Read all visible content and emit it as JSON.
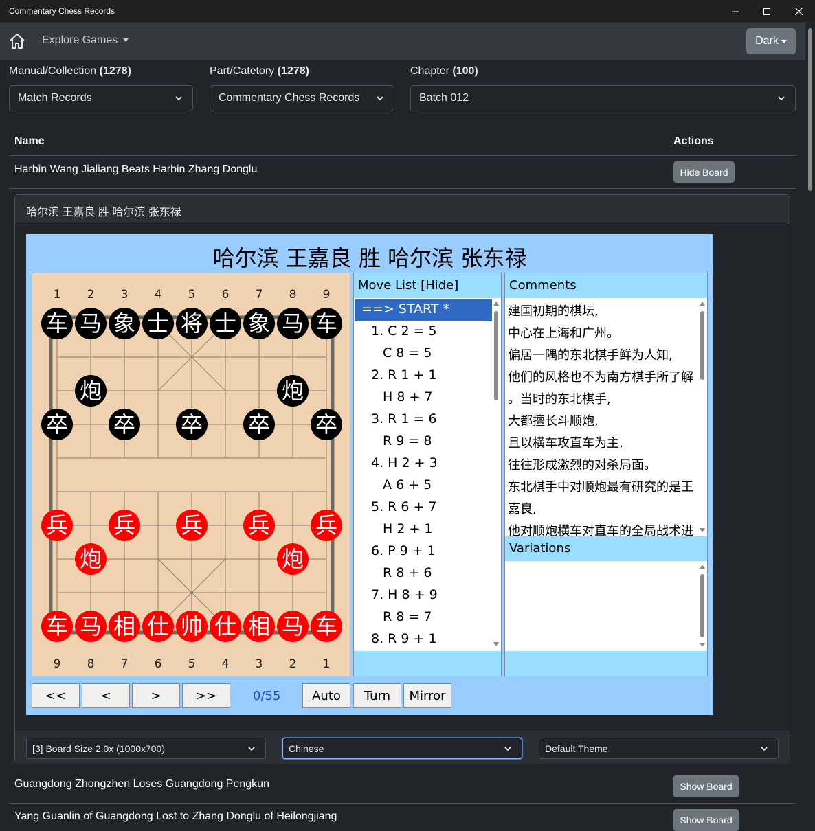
{
  "window": {
    "title": "Commentary Chess Records",
    "minimize": "—",
    "maximize": "☐",
    "close": "✕"
  },
  "navbar": {
    "home_icon": "home-icon",
    "explore_label": "Explore Games",
    "theme_label": "Dark"
  },
  "filters": [
    {
      "label": "Manual/Collection",
      "count": "(1278)",
      "value": "Match Records"
    },
    {
      "label": "Part/Catetory",
      "count": "(1278)",
      "value": "Commentary Chess Records"
    },
    {
      "label": "Chapter",
      "count": "(100)",
      "value": "Batch 012"
    }
  ],
  "table": {
    "headers": {
      "name": "Name",
      "actions": "Actions"
    },
    "rows": [
      {
        "name": "Harbin Wang Jialiang Beats Harbin Zhang Donglu",
        "action": "Hide Board"
      },
      {
        "name": "Guangdong Zhongzhen Loses Guangdong Pengkun",
        "action": "Show Board"
      },
      {
        "name": "Yang Guanlin of Guangdong Lost to Zhang Donglu of Heilongjiang",
        "action": "Show Board"
      }
    ]
  },
  "card": {
    "header": "哈尔滨 王嘉良 胜 哈尔滨 张东禄"
  },
  "game": {
    "title": "哈尔滨 王嘉良 胜 哈尔滨 张东禄",
    "top_files": [
      "1",
      "2",
      "3",
      "4",
      "5",
      "6",
      "7",
      "8",
      "9"
    ],
    "bottom_files": [
      "9",
      "8",
      "7",
      "6",
      "5",
      "4",
      "3",
      "2",
      "1"
    ],
    "black_pieces": [
      {
        "c": "车",
        "f": 0,
        "r": 0
      },
      {
        "c": "马",
        "f": 1,
        "r": 0
      },
      {
        "c": "象",
        "f": 2,
        "r": 0
      },
      {
        "c": "士",
        "f": 3,
        "r": 0
      },
      {
        "c": "将",
        "f": 4,
        "r": 0
      },
      {
        "c": "士",
        "f": 5,
        "r": 0
      },
      {
        "c": "象",
        "f": 6,
        "r": 0
      },
      {
        "c": "马",
        "f": 7,
        "r": 0
      },
      {
        "c": "车",
        "f": 8,
        "r": 0
      },
      {
        "c": "炮",
        "f": 1,
        "r": 2
      },
      {
        "c": "炮",
        "f": 7,
        "r": 2
      },
      {
        "c": "卒",
        "f": 0,
        "r": 3
      },
      {
        "c": "卒",
        "f": 2,
        "r": 3
      },
      {
        "c": "卒",
        "f": 4,
        "r": 3
      },
      {
        "c": "卒",
        "f": 6,
        "r": 3
      },
      {
        "c": "卒",
        "f": 8,
        "r": 3
      }
    ],
    "red_pieces": [
      {
        "c": "兵",
        "f": 0,
        "r": 6
      },
      {
        "c": "兵",
        "f": 2,
        "r": 6
      },
      {
        "c": "兵",
        "f": 4,
        "r": 6
      },
      {
        "c": "兵",
        "f": 6,
        "r": 6
      },
      {
        "c": "兵",
        "f": 8,
        "r": 6
      },
      {
        "c": "炮",
        "f": 1,
        "r": 7
      },
      {
        "c": "炮",
        "f": 7,
        "r": 7
      },
      {
        "c": "车",
        "f": 0,
        "r": 9
      },
      {
        "c": "马",
        "f": 1,
        "r": 9
      },
      {
        "c": "相",
        "f": 2,
        "r": 9
      },
      {
        "c": "仕",
        "f": 3,
        "r": 9
      },
      {
        "c": "帅",
        "f": 4,
        "r": 9
      },
      {
        "c": "仕",
        "f": 5,
        "r": 9
      },
      {
        "c": "相",
        "f": 6,
        "r": 9
      },
      {
        "c": "马",
        "f": 7,
        "r": 9
      },
      {
        "c": "车",
        "f": 8,
        "r": 9
      }
    ],
    "move_list_title": "Move List [Hide]",
    "moves": [
      "==> START *",
      "1. C 2 = 5",
      "C 8 = 5",
      "2. R 1 + 1",
      "H 8 + 7",
      "3. R 1 = 6",
      "R 9 = 8",
      "4. H 2 + 3",
      "A 6 + 5",
      "5. R 6 + 7",
      "H 2 + 1",
      "6. P 9 + 1",
      "R 8 + 6",
      "7. H 8 + 9",
      "R 8 = 7",
      "8. R 9 + 1"
    ],
    "comments_title": "Comments",
    "comments": [
      "建国初期的棋坛,",
      "中心在上海和广州。",
      "偏居一隅的东北棋手鲜为人知,",
      "他们的风格也不为南方棋手所了解",
      "。当时的东北棋手,",
      "大都擅长斗顺炮,",
      "且以横车攻直车为主,",
      "往往形成激烈的对杀局面。",
      "东北棋手中对顺炮最有研究的是王",
      "嘉良,",
      "他对顺炮横车对直车的全局战术进"
    ],
    "variations_title": "Variations",
    "controls": {
      "first": "<<",
      "prev": "<",
      "next": ">",
      "last": ">>",
      "counter": "0/55",
      "auto": "Auto",
      "turn": "Turn",
      "mirror": "Mirror"
    }
  },
  "footer": {
    "board_size": "[3] Board Size 2.0x (1000x700)",
    "language": "Chinese",
    "theme": "Default Theme"
  }
}
